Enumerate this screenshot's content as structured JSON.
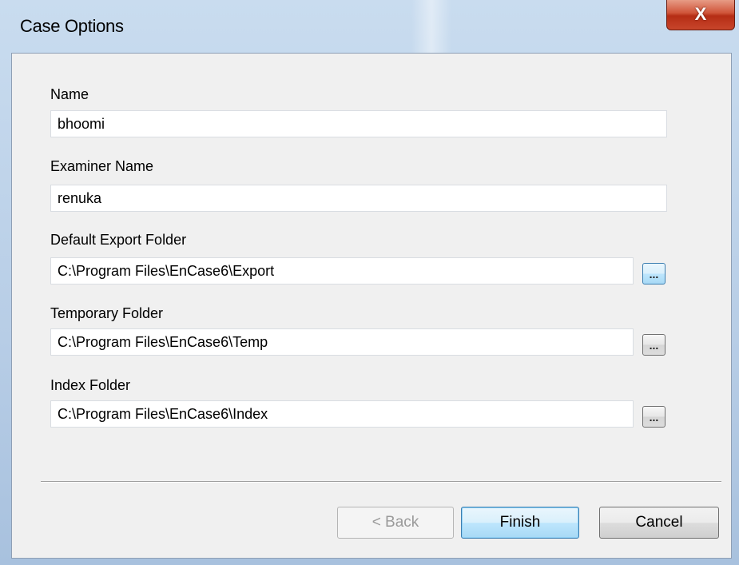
{
  "window": {
    "title": "Case Options",
    "close_glyph": "X"
  },
  "fields": {
    "name": {
      "label": "Name",
      "value": "bhoomi"
    },
    "examiner": {
      "label": "Examiner Name",
      "value": "renuka"
    },
    "export_folder": {
      "label": "Default Export Folder",
      "value": "C:\\Program Files\\EnCase6\\Export",
      "browse_label": "..."
    },
    "temp_folder": {
      "label": "Temporary Folder",
      "value": "C:\\Program Files\\EnCase6\\Temp",
      "browse_label": "..."
    },
    "index_folder": {
      "label": "Index Folder",
      "value": "C:\\Program Files\\EnCase6\\Index",
      "browse_label": "..."
    }
  },
  "buttons": {
    "back": "< Back",
    "finish": "Finish",
    "cancel": "Cancel"
  },
  "colors": {
    "title_bar": "#b7cde6",
    "close_button": "#c8452b",
    "dialog_background": "#f0f0f0",
    "default_button_accent": "#3c7fb1"
  },
  "icons": {
    "close": "close-icon"
  }
}
